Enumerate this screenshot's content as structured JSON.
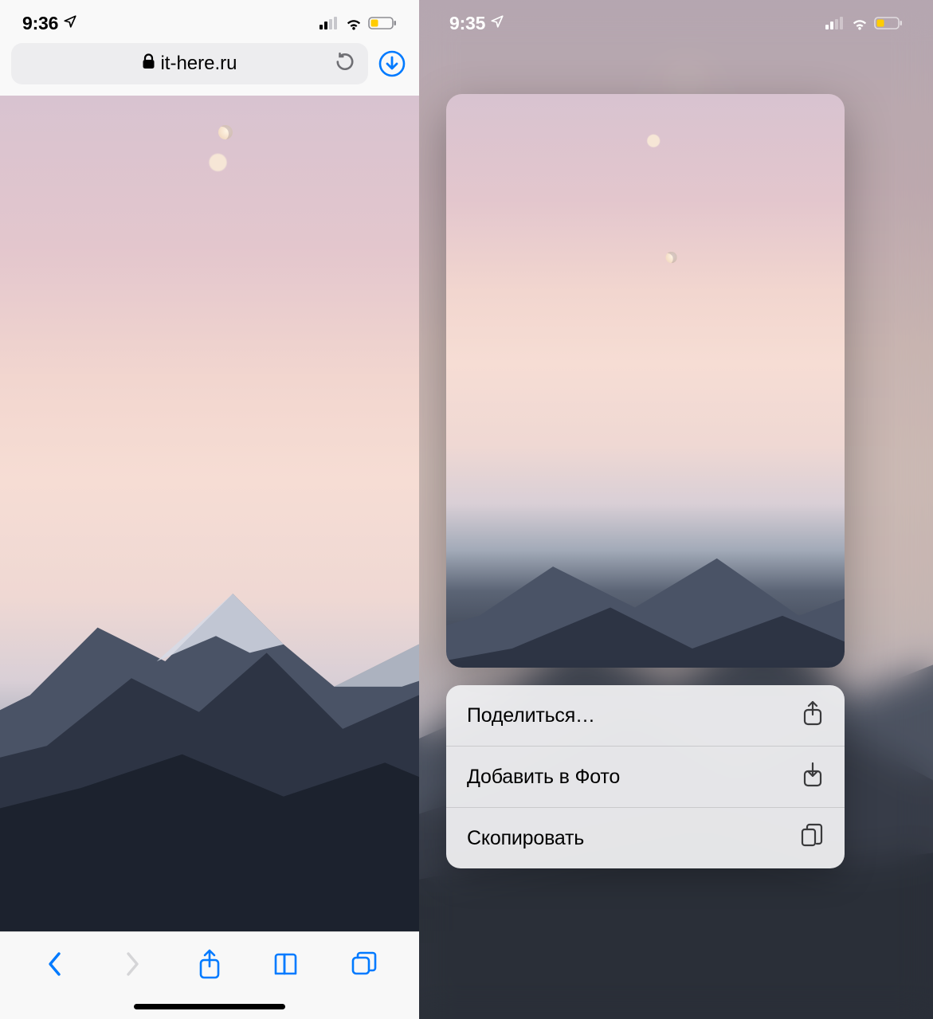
{
  "left": {
    "status": {
      "time": "9:36"
    },
    "url_bar": {
      "domain": "it-here.ru"
    }
  },
  "right": {
    "status": {
      "time": "9:35"
    },
    "menu": {
      "items": [
        {
          "name": "share",
          "label": "Поделиться…",
          "icon": "share-icon"
        },
        {
          "name": "save",
          "label": "Добавить в Фото",
          "icon": "download-icon"
        },
        {
          "name": "copy",
          "label": "Скопировать",
          "icon": "copy-icon"
        }
      ]
    }
  }
}
